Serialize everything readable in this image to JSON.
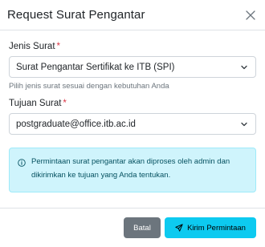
{
  "modal": {
    "title": "Request Surat Pengantar"
  },
  "form": {
    "jenis_surat": {
      "label": "Jenis Surat",
      "required_mark": "*",
      "value": "Surat Pengantar Sertifikat ke ITB (SPI)",
      "help": "Pilih jenis surat sesuai dengan kebutuhan Anda"
    },
    "tujuan_surat": {
      "label": "Tujuan Surat",
      "required_mark": "*",
      "value": "postgraduate@office.itb.ac.id"
    }
  },
  "alert": {
    "text": "Permintaan surat pengantar akan diproses oleh admin dan dikirimkan ke tujuan yang Anda tentukan."
  },
  "footer": {
    "cancel_label": "Batal",
    "submit_label": "Kirim Permintaan"
  },
  "icons": {
    "close": "close-icon",
    "chevron": "chevron-down-icon",
    "info": "info-circle-icon",
    "send": "send-icon"
  },
  "colors": {
    "alert_bg": "#cff4fc",
    "alert_border": "#9eeaf9",
    "alert_text": "#055160",
    "cancel_bg": "#6c757d",
    "submit_bg": "#0dcaf0",
    "required": "#dc3545"
  }
}
